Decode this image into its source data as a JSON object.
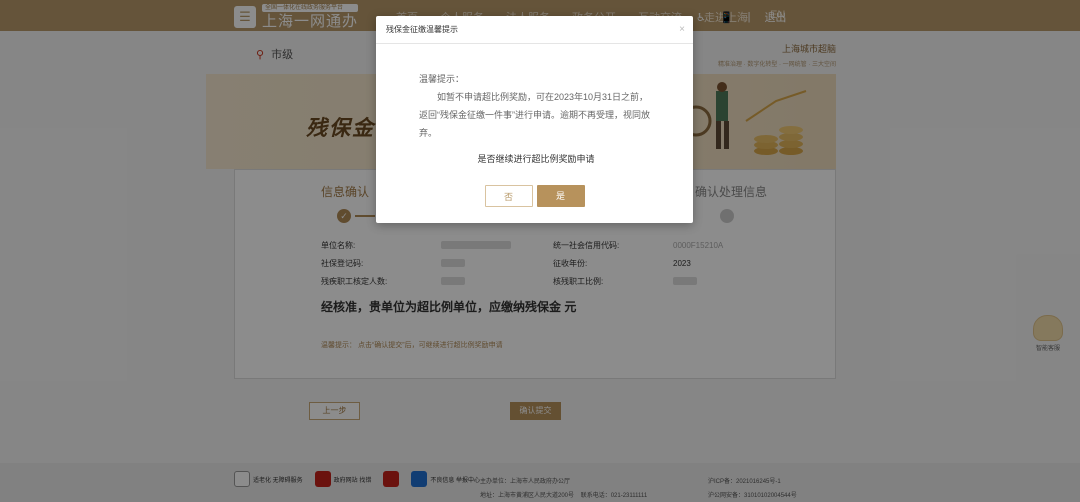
{
  "header": {
    "logo_small": "全国一体化在线政务服务平台",
    "logo_big": "上海一网通办",
    "nav": [
      "首页",
      "个人服务",
      "法人服务",
      "政务公开",
      "互动交流",
      "走进上海",
      "EN"
    ],
    "right": [
      "♿",
      "📱",
      "|",
      "退出"
    ]
  },
  "location": {
    "label": "市级"
  },
  "gov_brand": {
    "title": "上海城市超脑",
    "sub": "精准治理 · 数字化转型 · 一网统管 · 三大空间"
  },
  "banner": {
    "title": "残保金"
  },
  "steps": {
    "step1": "信息确认",
    "step3": "确认处理信息"
  },
  "fields": {
    "unit_name_label": "单位名称:",
    "credit_code_label": "统一社会信用代码:",
    "credit_code_value": "0000F15210A",
    "social_security_label": "社保登记码:",
    "year_label": "征收年份:",
    "year_value": "2023",
    "disabled_count_label": "残疾职工核定人数:",
    "disabled_ratio_label": "核残职工比例:"
  },
  "notice": "经核准，贵单位为超比例单位，应缴纳残保金   元",
  "tip": "温馨提示： 点击“确认提交”后，可继续进行超比例奖励申请",
  "buttons": {
    "prev": "上一步",
    "submit": "确认提交"
  },
  "footer": {
    "logo1": "适老化 无障碍服务",
    "logo2": "政府网站 找错",
    "logo4": "不良信息 举报中心",
    "host": "主办单位：上海市人民政府办公厅",
    "address": "地址：上海市黄浦区人民大道200号",
    "phone": "联系电话：021-23111111",
    "icp": "沪ICP备：2021016245号-1",
    "police": "沪公网安备：31010102004544号"
  },
  "assistant": {
    "label": "智能客服"
  },
  "modal": {
    "title": "残保金征缴温馨提示",
    "close": "×",
    "greeting": "温馨提示：",
    "line1": "如暂不申请超比例奖励，可在2023年10月31日之前，返回“残保金征缴一件事”进行申请。逾期不再受理，视同放弃。",
    "question": "是否继续进行超比例奖励申请",
    "no": "否",
    "yes": "是"
  }
}
